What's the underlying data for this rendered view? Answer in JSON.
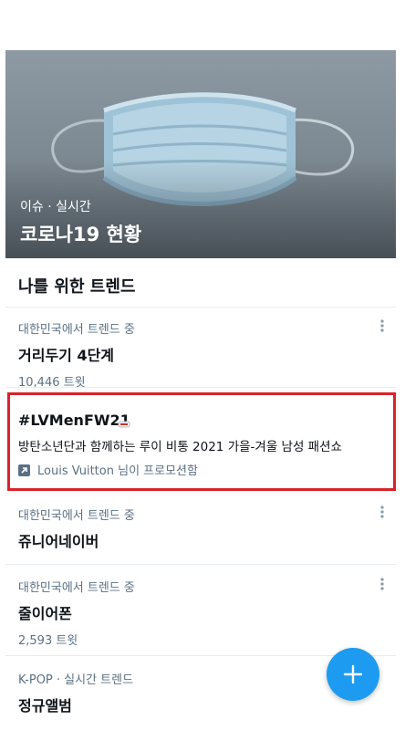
{
  "hero": {
    "subtitle": "이슈 · 실시간",
    "title": "코로나19 현황"
  },
  "section": {
    "title": "나를 위한 트렌드"
  },
  "trends": [
    {
      "meta": "대한민국에서 트렌드 중",
      "name": "거리두기 4단계",
      "count": "10,446 트윗"
    },
    {
      "meta": "대한민국에서 트렌드 중",
      "name": "쥬니어네이버",
      "count": ""
    },
    {
      "meta": "대한민국에서 트렌드 중",
      "name": "줄이어폰",
      "count": "2,593 트윗"
    },
    {
      "meta": "K-POP · 실시간 트렌드",
      "name": "정규앨범",
      "count": ""
    }
  ],
  "promoted": {
    "hashtag": "#LVMenFW21",
    "description": "방탄소년단과 함께하는 루이 비통 2021 가을-겨울 남성 패션쇼",
    "promoted_by": "Louis Vuitton 님이 프로모션함"
  },
  "icons": {
    "more": "more-icon",
    "promoted": "promoted-arrow-icon",
    "compose": "plus-icon"
  },
  "colors": {
    "accent": "#1d9bf0",
    "highlight_border": "#d8232a",
    "secondary_text": "#5b7083"
  }
}
